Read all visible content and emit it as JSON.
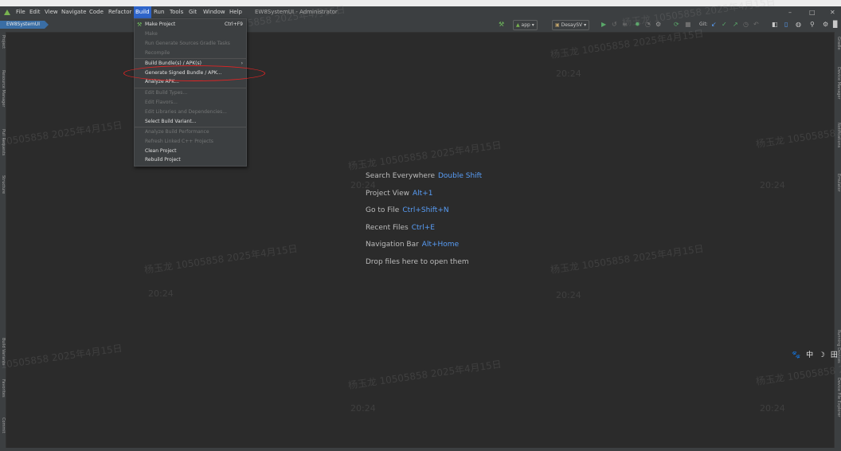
{
  "menubar": {
    "items": [
      "File",
      "Edit",
      "View",
      "Navigate",
      "Code",
      "Refactor",
      "Build",
      "Run",
      "Tools",
      "Git",
      "Window",
      "Help"
    ],
    "window_title": "EW8SystemUI - Administrator",
    "controls": [
      "–",
      "□",
      "✕"
    ]
  },
  "toolbar": {
    "breadcrumb": "EW8SystemUI",
    "run_config": "app",
    "device": "DesaySV",
    "git_label": "Git:"
  },
  "build_menu": {
    "items": [
      {
        "label": "Make Project",
        "shortcut": "Ctrl+F9",
        "enabled": true,
        "icon": "hammer-icon"
      },
      {
        "label": "Make",
        "enabled": false
      },
      {
        "label": "Run Generate Sources Gradle Tasks",
        "enabled": false
      },
      {
        "label": "Recompile",
        "enabled": false
      },
      {
        "label": "Build Bundle(s) / APK(s)",
        "enabled": true,
        "submenu": true
      },
      {
        "label": "Generate Signed Bundle / APK...",
        "enabled": true
      },
      {
        "label": "Analyze APK...",
        "enabled": true
      },
      {
        "label": "Edit Build Types...",
        "enabled": false
      },
      {
        "label": "Edit Flavors...",
        "enabled": false
      },
      {
        "label": "Edit Libraries and Dependencies...",
        "enabled": false
      },
      {
        "label": "Select Build Variant...",
        "enabled": true
      },
      {
        "label": "Analyze Build Performance",
        "enabled": false
      },
      {
        "label": "Refresh Linked C++ Projects",
        "enabled": false
      },
      {
        "label": "Clean Project",
        "enabled": true
      },
      {
        "label": "Rebuild Project",
        "enabled": true
      }
    ]
  },
  "editor_hints": [
    {
      "text": "Search Everywhere",
      "key": "Double Shift"
    },
    {
      "text": "Project View",
      "key": "Alt+1"
    },
    {
      "text": "Go to File",
      "key": "Ctrl+Shift+N"
    },
    {
      "text": "Recent Files",
      "key": "Ctrl+E"
    },
    {
      "text": "Navigation Bar",
      "key": "Alt+Home"
    },
    {
      "text": "Drop files here to open them",
      "key": ""
    }
  ],
  "left_tool_windows": [
    "Project",
    "Resource Manager",
    "Pull Requests",
    "Structure",
    "Build Variants",
    "Favorites",
    "Commit"
  ],
  "right_tool_windows": [
    "Gradle",
    "Device Manager",
    "Notifications",
    "Emulator",
    "Running Devices",
    "Device File Explorer"
  ],
  "watermark": {
    "line1": "杨玉龙 10505858 2025年4月15日",
    "line2": "20:24"
  },
  "ime_indicator": "🐾 中 ☽ 田",
  "colors": {
    "accent": "#2f65ca",
    "highlight_ellipse": "#e02424",
    "hint_key": "#589df6",
    "background": "#2b2b2b"
  }
}
